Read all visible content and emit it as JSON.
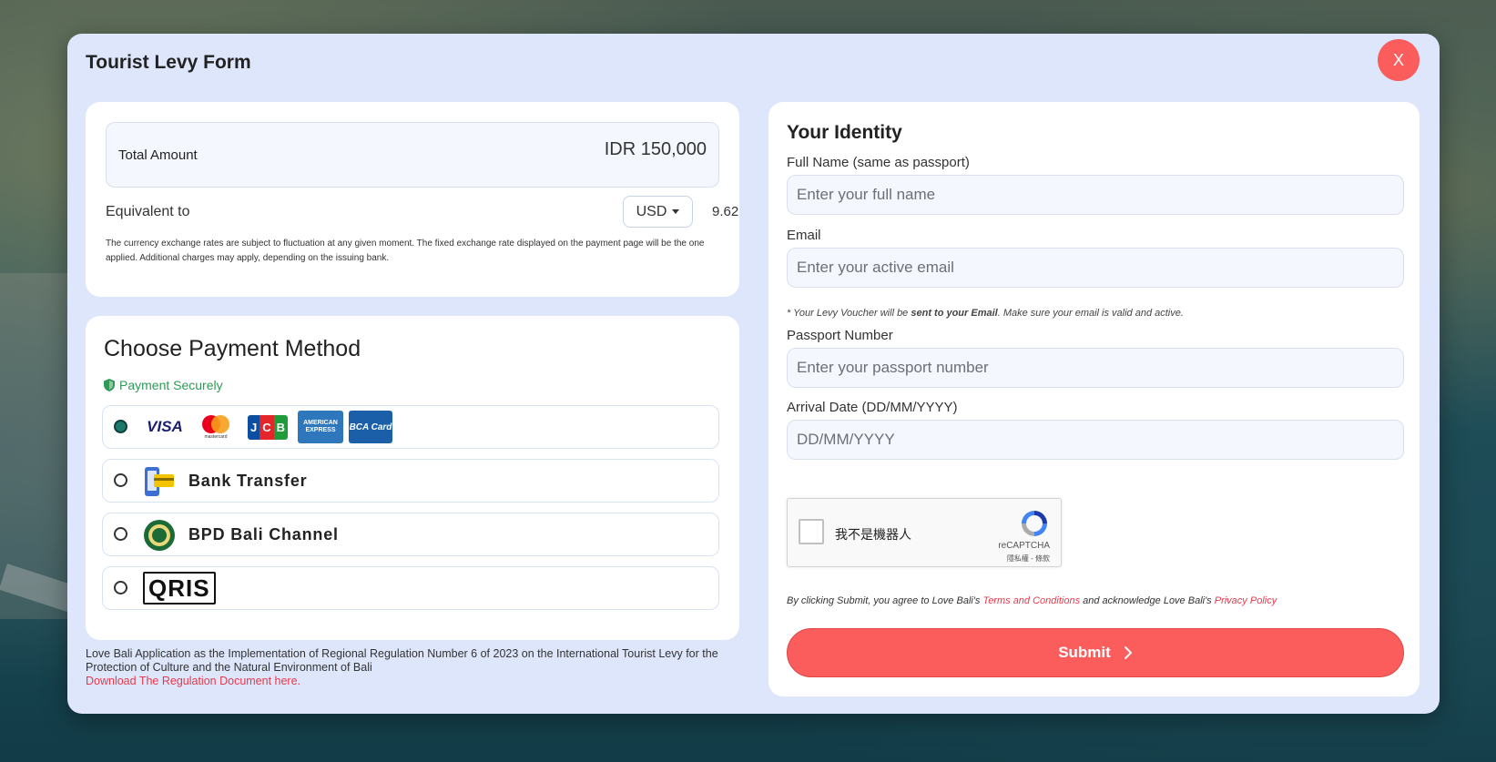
{
  "modal": {
    "title": "Tourist Levy Form",
    "close_label": "X"
  },
  "amount": {
    "total_label": "Total Amount",
    "total_value": "IDR 150,000",
    "equivalent_label": "Equivalent to",
    "currency": "USD",
    "equivalent_value": "9.62",
    "disclaimer": "The currency exchange rates are subject to fluctuation at any given moment. The fixed exchange rate displayed on the payment page will be the one applied. Additional charges may apply, depending on the issuing bank."
  },
  "payment": {
    "title": "Choose Payment Method",
    "secure_label": "Payment Securely",
    "card_logos": [
      "VISA",
      "mastercard",
      "JCB",
      "AMERICAN EXPRESS",
      "BCA Card"
    ],
    "options": [
      {
        "label": "",
        "selected": true
      },
      {
        "label": "Bank Transfer",
        "selected": false
      },
      {
        "label": "BPD Bali Channel",
        "selected": false
      },
      {
        "label": "QRIS",
        "selected": false
      }
    ]
  },
  "footer": {
    "note": "Love Bali Application as the Implementation of Regional Regulation Number 6 of 2023 on the International Tourist Levy for the Protection of Culture and the Natural Environment of Bali",
    "link": "Download The Regulation Document here."
  },
  "identity": {
    "title": "Your Identity",
    "full_name_label": "Full Name (same as passport)",
    "full_name_placeholder": "Enter your full name",
    "email_label": "Email",
    "email_placeholder": "Enter your active email",
    "email_note_prefix": "* Your Levy Voucher will be ",
    "email_note_bold": "sent to your Email",
    "email_note_suffix": ". Make sure your email is valid and active.",
    "passport_label": "Passport Number",
    "passport_placeholder": "Enter your passport number",
    "arrival_label": "Arrival Date (DD/MM/YYYY)",
    "arrival_placeholder": "DD/MM/YYYY"
  },
  "captcha": {
    "text": "我不是機器人",
    "brand": "reCAPTCHA",
    "links": "隱私權 - 條款"
  },
  "agreement": {
    "prefix": "By clicking Submit, you agree to Love Bali's ",
    "terms": "Terms and Conditions",
    "middle": " and acknowledge Love Bali's ",
    "privacy": "Privacy Policy"
  },
  "submit_label": "Submit",
  "colors": {
    "accent": "#fb5c5c",
    "modal_bg": "#dde6fb",
    "secure_green": "#2e9b57",
    "link_red": "#e8394a"
  }
}
